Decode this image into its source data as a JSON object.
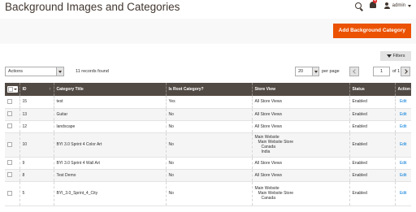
{
  "header": {
    "title": "Background Images and Categories",
    "notifications_count": "4",
    "user": "admin"
  },
  "actions": {
    "add_button": "Add Background Category",
    "filters_label": "Filters"
  },
  "toolbar": {
    "mass_action": "Actions",
    "records_found": "11 records found",
    "page_size": "20",
    "per_page_label": "per page",
    "current_page": "1",
    "of_pages": "of 1"
  },
  "table": {
    "columns": [
      "ID",
      "Category Title",
      "Is Root Category?",
      "Store View",
      "Status",
      "Action"
    ],
    "rows": [
      {
        "id": "15",
        "title": "test",
        "root": "Yes",
        "store": [
          "All Store Views"
        ],
        "status": "Enabled",
        "action": "Edit"
      },
      {
        "id": "13",
        "title": "Guitar",
        "root": "No",
        "store": [
          "All Store Views"
        ],
        "status": "Enabled",
        "action": "Edit"
      },
      {
        "id": "12",
        "title": "landscape",
        "root": "No",
        "store": [
          "All Store Views"
        ],
        "status": "Enabled",
        "action": "Edit"
      },
      {
        "id": "10",
        "title": "BYI 3.0 Sprint 4 Color Art",
        "root": "No",
        "store": [
          "Main Website",
          "Main Website Store",
          "Canada",
          "India"
        ],
        "status": "Enabled",
        "action": "Edit"
      },
      {
        "id": "9",
        "title": "BYI 3.0 Sprint 4 Wall Art",
        "root": "No",
        "store": [
          "All Store Views"
        ],
        "status": "Enabled",
        "action": "Edit"
      },
      {
        "id": "8",
        "title": "Test Demo",
        "root": "No",
        "store": [
          "All Store Views"
        ],
        "status": "Enabled",
        "action": "Edit"
      },
      {
        "id": "5",
        "title": "BYI_3.0_Sprint_4_City",
        "root": "No",
        "store": [
          "Main Website",
          "Main Website Store",
          "Canada"
        ],
        "status": "Enabled",
        "action": "Edit"
      }
    ]
  }
}
